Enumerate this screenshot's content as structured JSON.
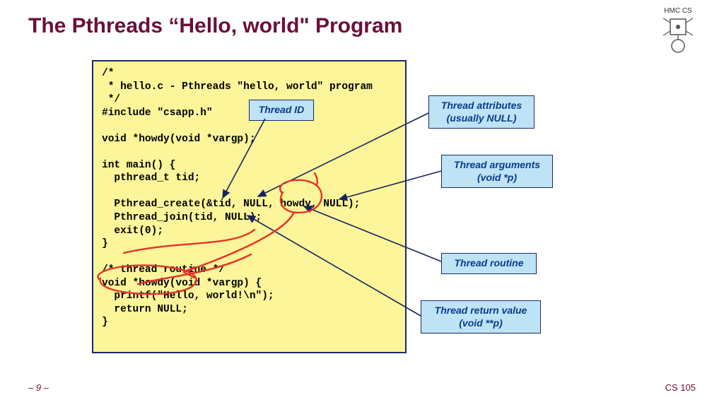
{
  "title": "The Pthreads “Hello, world\" Program",
  "code": "/*\n * hello.c - Pthreads \"hello, world\" program\n */\n#include \"csapp.h\"\n\nvoid *howdy(void *vargp);\n\nint main() {\n  pthread_t tid;\n\n  Pthread_create(&tid, NULL, howdy, NULL);\n  Pthread_join(tid, NULL);\n  exit(0);\n}\n\n/* thread routine */\nvoid *howdy(void *vargp) {\n  printf(\"Hello, world!\\n\");\n  return NULL;\n}",
  "callouts": {
    "thread_id": "Thread ID",
    "attrs": "Thread attributes\n(usually NULL)",
    "args": "Thread arguments\n(void *p)",
    "routine": "Thread routine",
    "retval": "Thread return value\n(void **p)"
  },
  "footer": {
    "page": "– 9 –",
    "course": "CS 105"
  },
  "logo_text": "HMC  CS"
}
